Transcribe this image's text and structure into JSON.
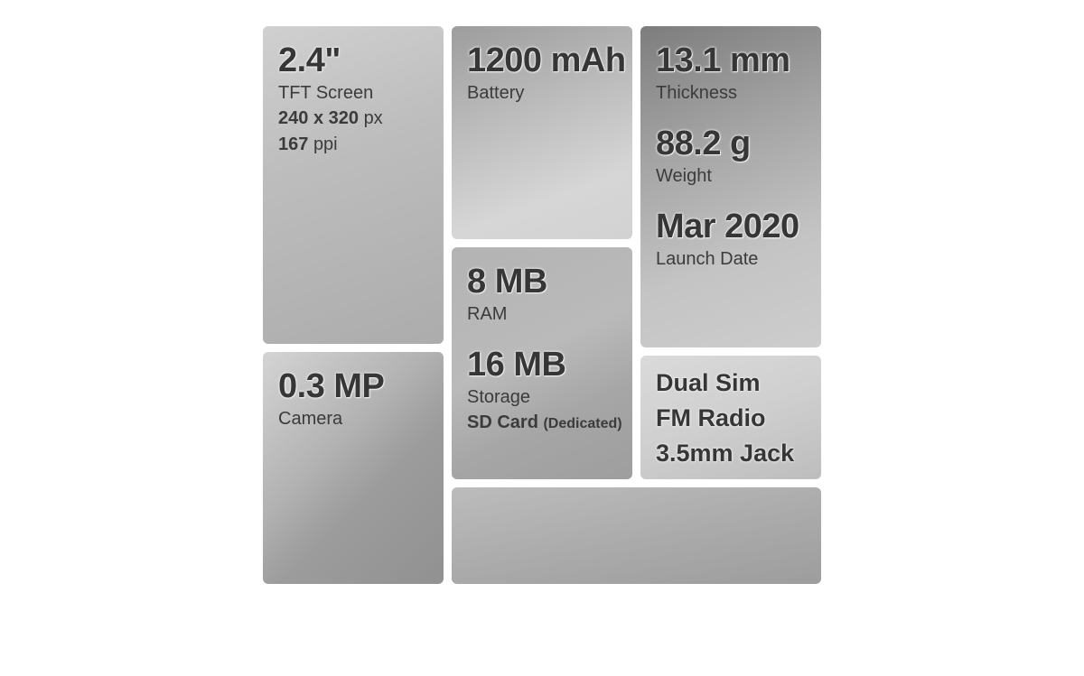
{
  "screen": {
    "size": "2.4\"",
    "type": "TFT Screen",
    "res_w": "240",
    "res_x": "x",
    "res_h": "320",
    "res_unit": "px",
    "density": "167",
    "density_unit": "ppi"
  },
  "camera": {
    "value": "0.3 MP",
    "label": "Camera"
  },
  "battery": {
    "value": "1200 mAh",
    "label": "Battery"
  },
  "memory": {
    "ram_value": "8 MB",
    "ram_label": "RAM",
    "storage_value": "16 MB",
    "storage_label": "Storage",
    "card": "SD Card",
    "card_note": "(Dedicated)"
  },
  "body": {
    "thickness_value": "13.1 mm",
    "thickness_label": "Thickness",
    "weight_value": "88.2 g",
    "weight_label": "Weight",
    "launch_value": "Mar 2020",
    "launch_label": "Launch Date"
  },
  "features": [
    "Dual Sim",
    "FM Radio",
    "3.5mm Jack"
  ]
}
